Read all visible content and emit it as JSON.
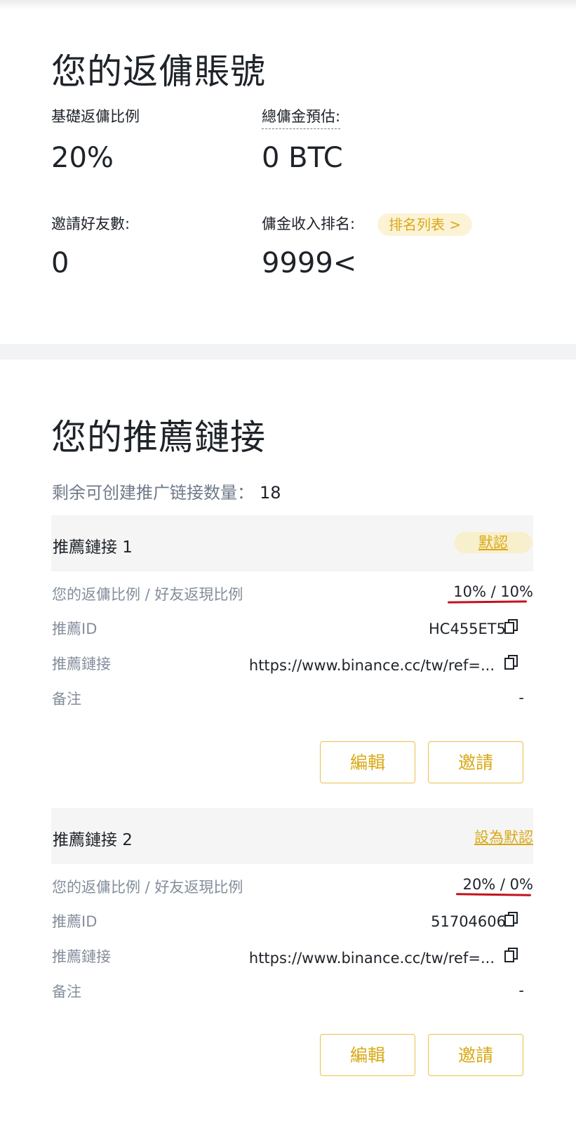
{
  "account": {
    "title": "您的返傭賬號",
    "base_rate_label": "基礎返傭比例",
    "base_rate_value": "20%",
    "total_commission_label": "總傭金預估:",
    "total_commission_value": "0 BTC",
    "invited_friends_label": "邀請好友數:",
    "invited_friends_value": "0",
    "commission_rank_label": "傭金收入排名:",
    "rank_list_button": "排名列表 >",
    "commission_rank_value": "9999<"
  },
  "links_section": {
    "title": "您的推薦鏈接",
    "remaining_label": "剩余可创建推广链接数量：",
    "remaining_count": "18"
  },
  "links": [
    {
      "title": "推薦鏈接 1",
      "status_label": "默認",
      "ratio_label": "您的返傭比例 / 好友返現比例",
      "ratio_value": "10% / 10%",
      "id_label": "推薦ID",
      "id_value": "HC455ET5",
      "link_label": "推薦鏈接",
      "link_value": "https://www.binance.cc/tw/ref=...",
      "note_label": "备注",
      "note_value": "-",
      "edit_button": "編輯",
      "invite_button": "邀請"
    },
    {
      "title": "推薦鏈接 2",
      "status_label": "設為默認",
      "ratio_label": "您的返傭比例 / 好友返現比例",
      "ratio_value": "20% / 0%",
      "id_label": "推薦ID",
      "id_value": "51704606",
      "link_label": "推薦鏈接",
      "link_value": "https://www.binance.cc/tw/ref=...",
      "note_label": "备注",
      "note_value": "-",
      "edit_button": "編輯",
      "invite_button": "邀請"
    }
  ],
  "colors": {
    "accent": "#d9a916",
    "annotation_underline": "#c3121e",
    "muted_text": "#848e9c",
    "primary_text": "#1e2329"
  },
  "icons": {
    "copy": "copy-icon"
  }
}
